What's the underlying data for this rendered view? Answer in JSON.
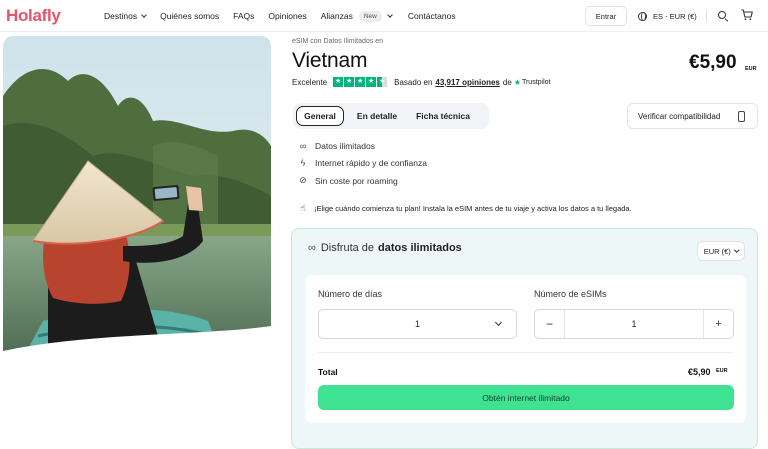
{
  "header": {
    "logo": "Holafly",
    "nav": {
      "destinos": "Destinos",
      "quienes": "Quiénes somos",
      "faqs": "FAQs",
      "opiniones": "Opiniones",
      "alianzas": "Alianzas",
      "new_badge": "New",
      "contactanos": "Contáctanos"
    },
    "login_label": "Entrar",
    "language": "ES - EUR (€)",
    "icons": [
      "globe-icon",
      "search-icon",
      "cart-icon"
    ]
  },
  "product": {
    "breadcrumb": "eSIM con Datos Ilimitados en",
    "title": "Vietnam",
    "price": "€5,90",
    "price_currency": "EUR",
    "rating": {
      "label": "Excelente",
      "stars": 4.5,
      "based_on": "Basado en",
      "count_text": "43,917 opiniones",
      "of_text": "de",
      "brand": "Trustpilot"
    }
  },
  "tabs": [
    {
      "label": "General",
      "active": true
    },
    {
      "label": "En detalle",
      "active": false
    },
    {
      "label": "Ficha técnica",
      "active": false
    }
  ],
  "compatibility_button": "Verificar compatibilidad",
  "features": [
    {
      "icon": "infinity-icon",
      "text": "Datos ilimitados"
    },
    {
      "icon": "lightning-icon",
      "text": "Internet rápido y de confianza"
    },
    {
      "icon": "no-roaming-icon",
      "text": "Sin coste por roaming"
    }
  ],
  "tip": "¡Elige cuándo comienza tu plan! Instala la eSIM antes de tu viaje y activa los datos a tu llegada.",
  "plan": {
    "title_prefix": "Disfruta de",
    "title_bold": "datos ilimitados",
    "currency_select": "EUR (€)",
    "days_label": "Número de días",
    "days_value": "1",
    "esims_label": "Número de eSIMs",
    "esims_value": "1",
    "total_label": "Total",
    "total_price": "€5,90",
    "total_currency": "EUR",
    "cta": "Obtén internet ilimitado"
  },
  "colors": {
    "brand": "#e8526b",
    "cta": "#3fe192",
    "trustpilot": "#00b67a",
    "plan_bg": "#eef7f7"
  }
}
